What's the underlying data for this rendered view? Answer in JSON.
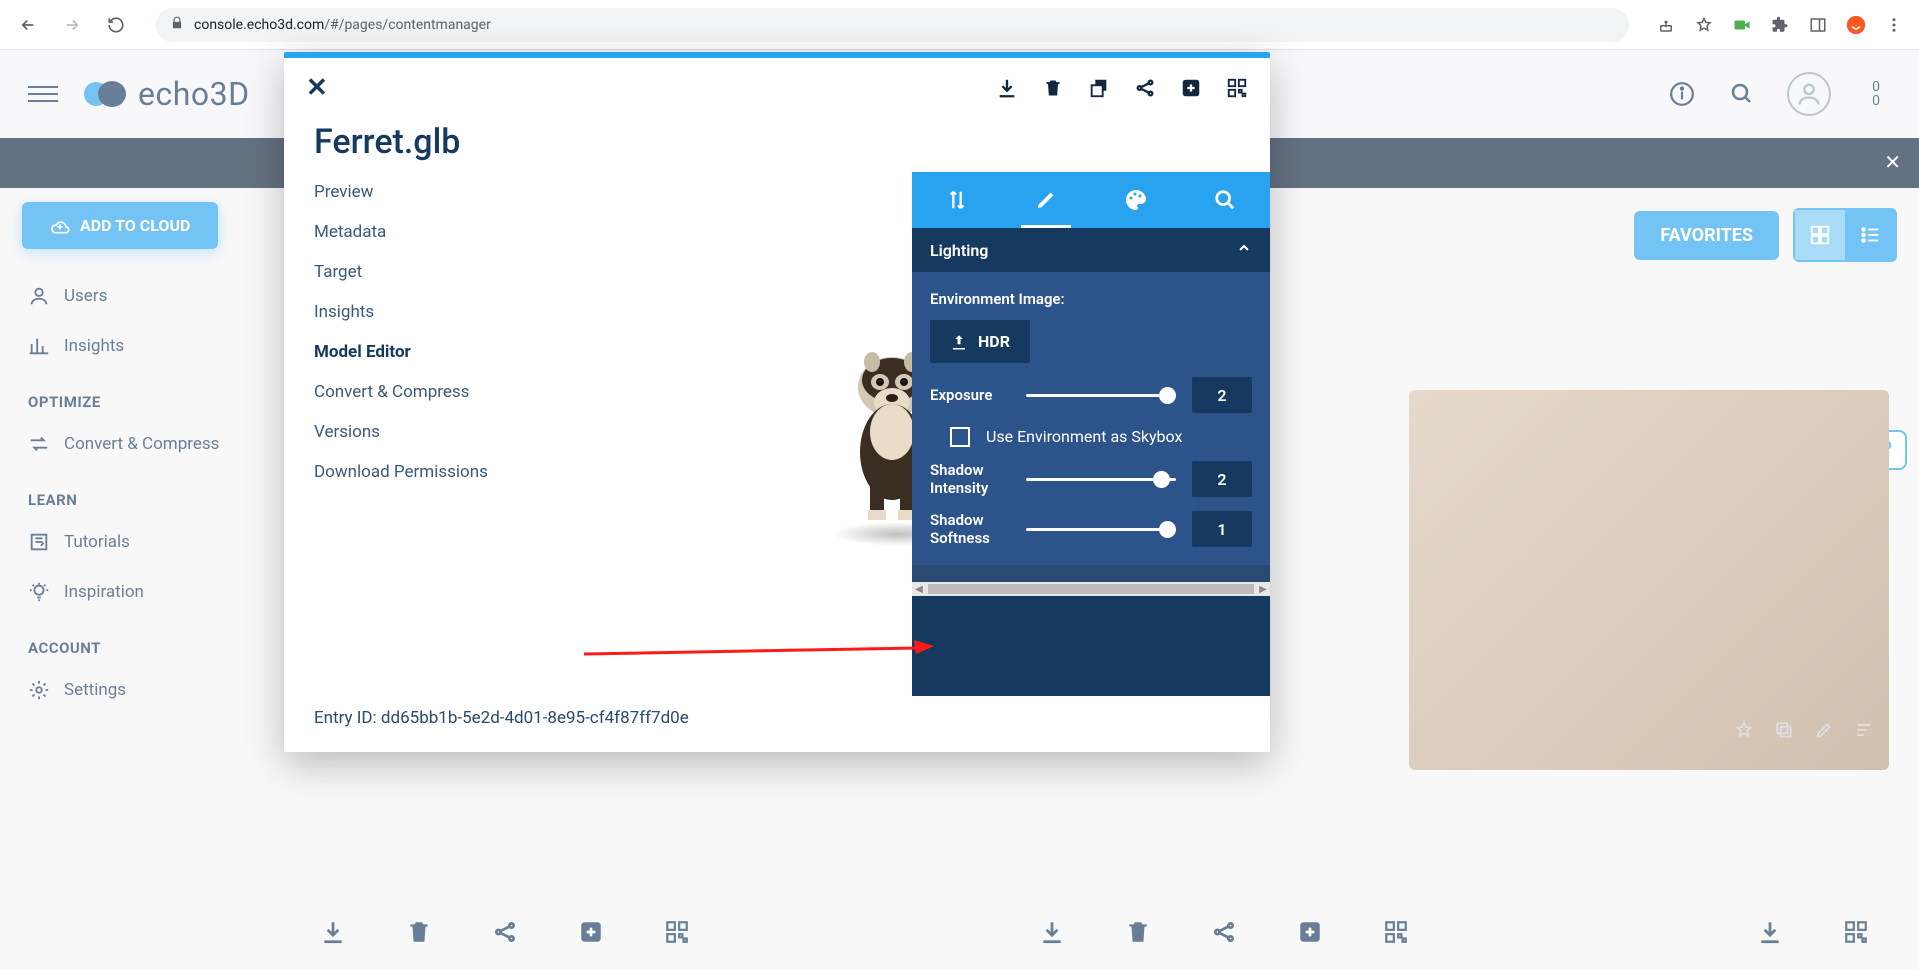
{
  "browser": {
    "url_host": "console.echo3d.com",
    "url_path": "/#/pages/contentmanager"
  },
  "app": {
    "brand": "echo3D"
  },
  "sidebar": {
    "add_to_cloud": "ADD TO CLOUD",
    "items": [
      {
        "label": "Users"
      },
      {
        "label": "Insights"
      }
    ],
    "section_optimize": "OPTIMIZE",
    "optimize_items": [
      {
        "label": "Convert & Compress"
      }
    ],
    "section_learn": "LEARN",
    "learn_items": [
      {
        "label": "Tutorials"
      },
      {
        "label": "Inspiration"
      }
    ],
    "section_account": "ACCOUNT",
    "account_items": [
      {
        "label": "Settings"
      }
    ]
  },
  "bg_toolbar": {
    "favorites": "FAVORITES"
  },
  "modal": {
    "title": "Ferret.glb",
    "nav": [
      "Preview",
      "Metadata",
      "Target",
      "Insights",
      "Model Editor",
      "Convert & Compress",
      "Versions",
      "Download Permissions"
    ],
    "entry_id_label": "Entry ID: ",
    "entry_id": "dd65bb1b-5e2d-4d01-8e95-cf4f87ff7d0e",
    "panel": {
      "section": "Lighting",
      "env_label": "Environment Image:",
      "hdr_btn": "HDR",
      "exposure": {
        "label": "Exposure",
        "value": "2"
      },
      "skybox_check": "Use Environment as Skybox",
      "shadow_intensity": {
        "label": "Shadow Intensity",
        "value": "2"
      },
      "shadow_softness": {
        "label": "Shadow Softness",
        "value": "1"
      }
    }
  }
}
